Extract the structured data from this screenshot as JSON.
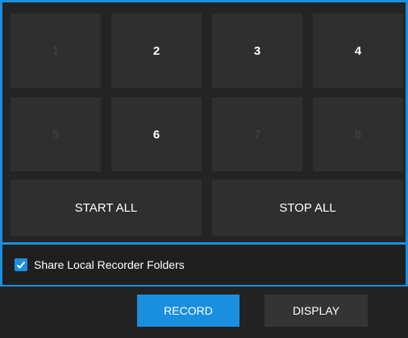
{
  "grid": {
    "cells": [
      {
        "label": "1",
        "enabled": false
      },
      {
        "label": "2",
        "enabled": true
      },
      {
        "label": "3",
        "enabled": true
      },
      {
        "label": "4",
        "enabled": true
      },
      {
        "label": "5",
        "enabled": false
      },
      {
        "label": "6",
        "enabled": true
      },
      {
        "label": "7",
        "enabled": false
      },
      {
        "label": "8",
        "enabled": false
      }
    ]
  },
  "actions": {
    "start_all": "START ALL",
    "stop_all": "STOP ALL"
  },
  "share": {
    "checked": true,
    "label": "Share Local Recorder Folders"
  },
  "footer": {
    "record_label": "RECORD",
    "display_label": "DISPLAY"
  },
  "colors": {
    "accent": "#1a8fe0",
    "background": "#1f1f1f",
    "tile": "#2f2f2f",
    "tile_disabled_text": "#454545",
    "text": "#ffffff"
  }
}
